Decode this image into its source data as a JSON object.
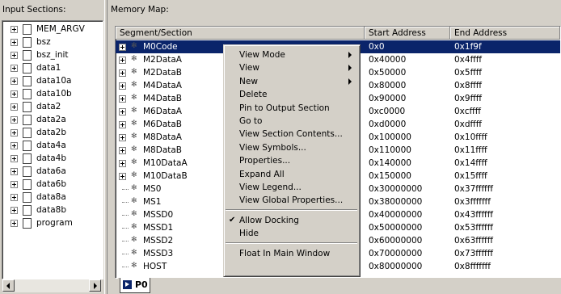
{
  "input_sections": {
    "caption": "Input Sections:",
    "items": [
      "MEM_ARGV",
      "bsz",
      "bsz_init",
      "data1",
      "data10a",
      "data10b",
      "data2",
      "data2a",
      "data2b",
      "data4a",
      "data4b",
      "data6a",
      "data6b",
      "data8a",
      "data8b",
      "program"
    ]
  },
  "memory_map": {
    "caption": "Memory Map:",
    "columns": [
      "Segment/Section",
      "Start Address",
      "End Address"
    ],
    "rows": [
      {
        "name": "M0Code",
        "start": "0x0",
        "end": "0x1f9f",
        "expandable": true,
        "selected": true
      },
      {
        "name": "M2DataA",
        "start": "0x40000",
        "end": "0x4ffff",
        "expandable": true
      },
      {
        "name": "M2DataB",
        "start": "0x50000",
        "end": "0x5ffff",
        "expandable": true
      },
      {
        "name": "M4DataA",
        "start": "0x80000",
        "end": "0x8ffff",
        "expandable": true
      },
      {
        "name": "M4DataB",
        "start": "0x90000",
        "end": "0x9ffff",
        "expandable": true
      },
      {
        "name": "M6DataA",
        "start": "0xc0000",
        "end": "0xcffff",
        "expandable": true
      },
      {
        "name": "M6DataB",
        "start": "0xd0000",
        "end": "0xdffff",
        "expandable": true
      },
      {
        "name": "M8DataA",
        "start": "0x100000",
        "end": "0x10ffff",
        "expandable": true
      },
      {
        "name": "M8DataB",
        "start": "0x110000",
        "end": "0x11ffff",
        "expandable": true
      },
      {
        "name": "M10DataA",
        "start": "0x140000",
        "end": "0x14ffff",
        "expandable": true
      },
      {
        "name": "M10DataB",
        "start": "0x150000",
        "end": "0x15ffff",
        "expandable": true
      },
      {
        "name": "MS0",
        "start": "0x30000000",
        "end": "0x37ffffff",
        "expandable": false
      },
      {
        "name": "MS1",
        "start": "0x38000000",
        "end": "0x3fffffff",
        "expandable": false
      },
      {
        "name": "MSSD0",
        "start": "0x40000000",
        "end": "0x43ffffff",
        "expandable": false
      },
      {
        "name": "MSSD1",
        "start": "0x50000000",
        "end": "0x53ffffff",
        "expandable": false
      },
      {
        "name": "MSSD2",
        "start": "0x60000000",
        "end": "0x63ffffff",
        "expandable": false
      },
      {
        "name": "MSSD3",
        "start": "0x70000000",
        "end": "0x73ffffff",
        "expandable": false
      },
      {
        "name": "HOST",
        "start": "0x80000000",
        "end": "0x8fffffff",
        "expandable": false
      }
    ]
  },
  "context_menu": {
    "items": [
      {
        "label": "View Mode",
        "submenu": true
      },
      {
        "label": "View",
        "submenu": true
      },
      {
        "label": "New",
        "submenu": true
      },
      {
        "label": "Delete"
      },
      {
        "label": "Pin to Output Section"
      },
      {
        "label": "Go to"
      },
      {
        "label": "View Section Contents..."
      },
      {
        "label": "View Symbols..."
      },
      {
        "label": "Properties..."
      },
      {
        "label": "Expand All"
      },
      {
        "label": "View Legend..."
      },
      {
        "label": "View Global Properties..."
      },
      {
        "separator": true
      },
      {
        "label": "Allow Docking",
        "checked": true
      },
      {
        "label": "Hide"
      },
      {
        "separator": true
      },
      {
        "label": "Float In Main Window"
      }
    ]
  },
  "bottom_tab": {
    "label": "P0",
    "icon": "processor-icon"
  },
  "colors": {
    "selection": "#0a246a",
    "face": "#d4d0c8"
  }
}
